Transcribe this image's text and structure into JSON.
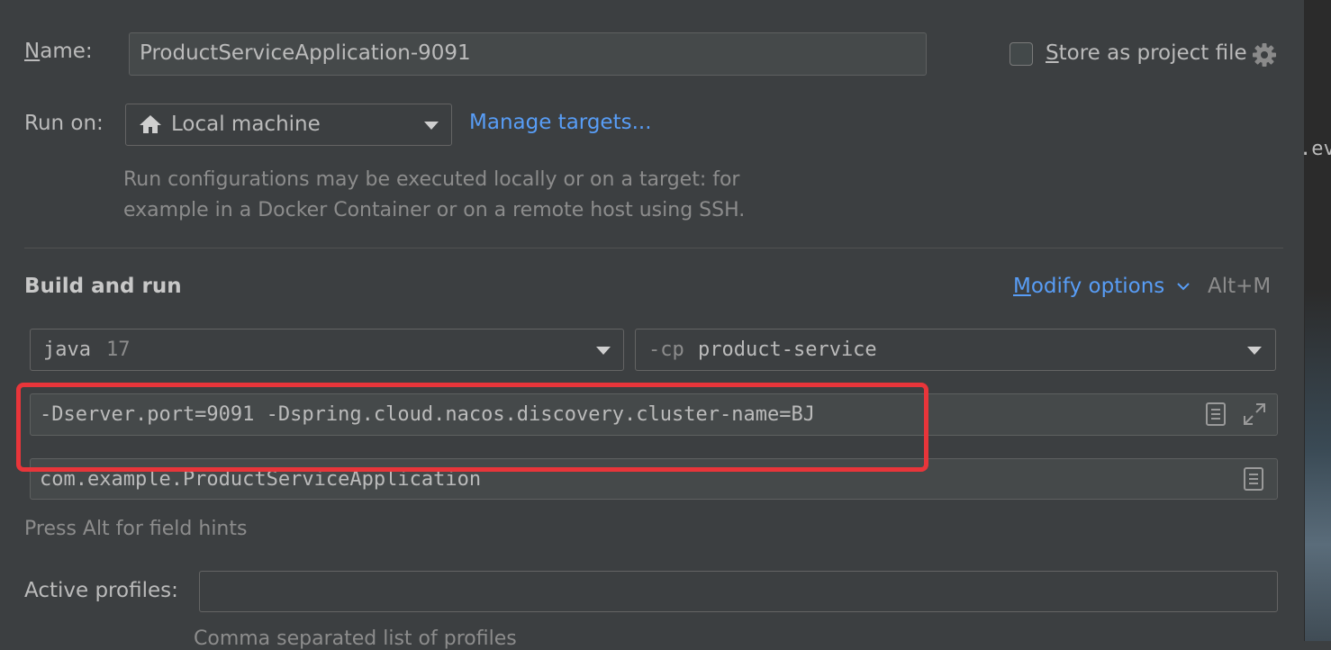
{
  "name_row": {
    "label": "Name:",
    "label_mnemonic": "N",
    "label_rest": "ame:",
    "value": "ProductServiceApplication-9091",
    "store_checkbox_label": "Store as project file",
    "store_mnemonic": "S",
    "store_rest": "tore as project file",
    "store_checked": false,
    "gear_icon": "gear-icon"
  },
  "run_on": {
    "label": "Run on:",
    "selected": "Local machine",
    "selected_icon": "home-icon",
    "manage_link": "Manage targets...",
    "hint_line1": "Run configurations may be executed locally or on a target: for",
    "hint_line2": "example in a Docker Container or on a remote host using SSH."
  },
  "build_and_run": {
    "heading": "Build and run",
    "modify_options": "Modify options",
    "modify_mnemonic": "M",
    "modify_rest": "odify options",
    "shortcut": "Alt+M",
    "jdk_prefix": "java",
    "jdk_version": "17",
    "cp_prefix": "-cp",
    "cp_module": "product-service",
    "vm_options": "-Dserver.port=9091 -Dspring.cloud.nacos.discovery.cluster-name=BJ",
    "main_class": "com.example.ProductServiceApplication",
    "field_hints": "Press Alt for field hints"
  },
  "profiles": {
    "label": "Active profiles:",
    "value": "",
    "hint": "Comma separated list of profiles"
  },
  "right_edge_text": ".ev",
  "colors": {
    "background": "#3c3f41",
    "link": "#589df6",
    "highlight_box": "#e8353a"
  }
}
